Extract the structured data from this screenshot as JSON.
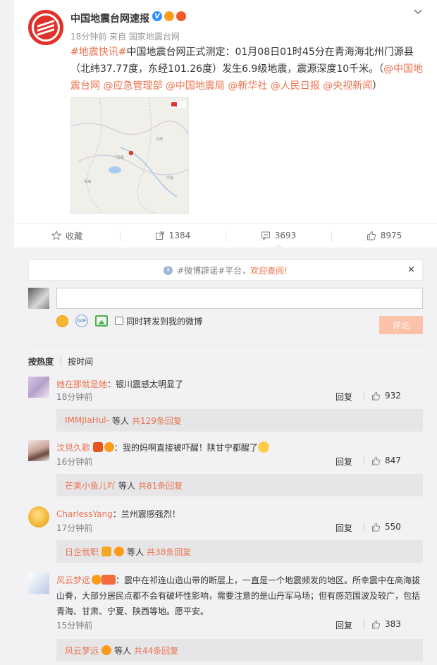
{
  "post": {
    "author": "中国地震台网速报",
    "meta": "18分钟前 来自 国家地震台网",
    "topic": "#地震快讯#",
    "text_main": "中国地震台网正式测定：01月08日01时45分在青海海北州门源县（北纬37.77度，东经101.26度）发生6.9级地震，震源深度10千米。（",
    "mentions": "@中国地震台网 @应急管理部 @中国地震局 @新华社 @人民日报 @央视新闻",
    "text_end": "）"
  },
  "actions": {
    "favorite": "收藏",
    "repost": "1384",
    "comment": "3693",
    "like": "8975"
  },
  "notice": {
    "text_prefix": "#微博辟谣#平台，",
    "text_link": "欢迎查阅!",
    "close": "×"
  },
  "composer": {
    "forward_label": "同时转发到我的微博",
    "submit": "评论"
  },
  "sort": {
    "hot": "按热度",
    "time": "按时间"
  },
  "comments": [
    {
      "name": "她在那就是她",
      "text": "：银川震感太明显了",
      "time": "18分钟前",
      "reply": "回复",
      "likes": "932",
      "sub_name": "IMMJIaHul-",
      "sub_mid": " 等人 ",
      "sub_count": "共129条回复"
    },
    {
      "name": "汶見久歡",
      "text": "：我的妈啊直接被吓醒！陕甘宁都醒了",
      "time": "16分钟前",
      "reply": "回复",
      "likes": "847",
      "sub_name": "芒果小鱼儿吖",
      "sub_mid": " 等人 ",
      "sub_count": "共81条回复"
    },
    {
      "name": "CharlessYang",
      "text": "：兰州震感强烈！",
      "time": "17分钟前",
      "reply": "回复",
      "likes": "550",
      "sub_name": "日企就职",
      "sub_mid": " 等人 ",
      "sub_count": "共38条回复"
    },
    {
      "name": "风云梦远",
      "text": "：震中在祁连山造山带的断层上，一直是一个地震频发的地区。所幸震中在高海拔山脊，大部分居民点都不会有破坏性影响，需要注意的是山丹军马场；但有感范围波及较广，包括青海、甘肃、宁夏、陕西等地。愿平安。",
      "time": "15分钟前",
      "reply": "回复",
      "likes": "383",
      "sub_name": "风云梦远",
      "sub_mid": " 等人 ",
      "sub_count": "共44条回复"
    }
  ],
  "colors": {
    "link": "#eb7350",
    "brand_red": "#e0322b",
    "submit_disabled": "#fcc1a9"
  }
}
